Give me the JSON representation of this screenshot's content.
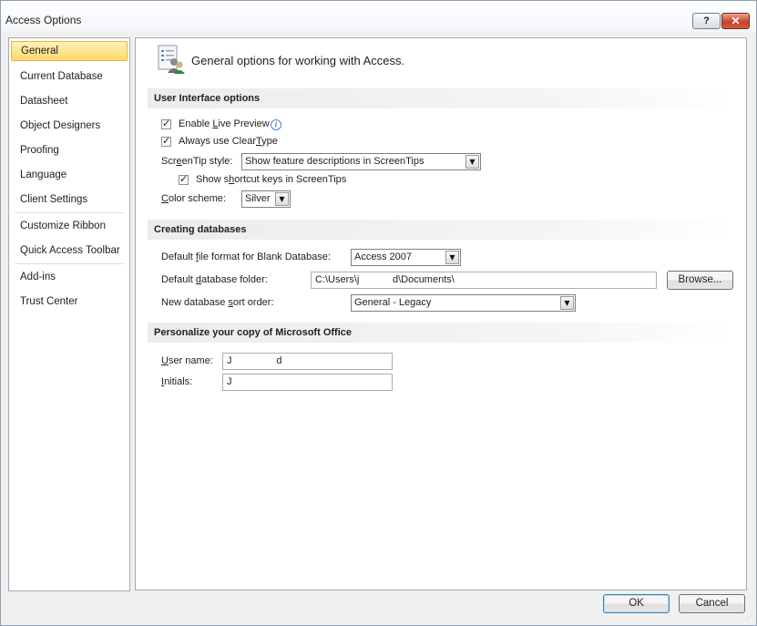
{
  "window": {
    "title": "Access Options",
    "help_label": "?",
    "close_label": "✕"
  },
  "sidebar": {
    "items": [
      {
        "label": "General",
        "selected": true
      },
      {
        "label": "Current Database"
      },
      {
        "label": "Datasheet"
      },
      {
        "label": "Object Designers"
      },
      {
        "label": "Proofing"
      },
      {
        "label": "Language"
      },
      {
        "label": "Client Settings"
      },
      {
        "label": "Customize Ribbon"
      },
      {
        "label": "Quick Access Toolbar"
      },
      {
        "label": "Add-ins"
      },
      {
        "label": "Trust Center"
      }
    ]
  },
  "header": {
    "title": "General options for working with Access.",
    "icon": "options-people-icon"
  },
  "ui_options": {
    "heading": "User Interface options",
    "live_preview": {
      "label_pre": "Enable ",
      "label_u": "L",
      "label_post": "ive Preview",
      "checked": true
    },
    "cleartype": {
      "label_pre": "Always use Clear",
      "label_u": "T",
      "label_post": "ype",
      "checked": true
    },
    "screentip": {
      "label_pre": "Scr",
      "label_u": "e",
      "label_post": "enTip style:",
      "value": "Show feature descriptions in ScreenTips"
    },
    "shortcut_keys": {
      "label_pre": "Show s",
      "label_u": "h",
      "label_post": "ortcut keys in ScreenTips",
      "checked": true
    },
    "color_scheme": {
      "label_pre": "",
      "label_u": "C",
      "label_post": "olor scheme:",
      "value": "Silver"
    }
  },
  "creating_db": {
    "heading": "Creating databases",
    "file_format": {
      "label_pre": "Default ",
      "label_u": "f",
      "label_post": "ile format for Blank Database:",
      "value": "Access 2007"
    },
    "folder": {
      "label_pre": "Default ",
      "label_u": "d",
      "label_post": "atabase folder:",
      "value": "C:\\Users\\j            d\\Documents\\"
    },
    "browse_label": "Browse...",
    "sort_order": {
      "label_pre": "New database ",
      "label_u": "s",
      "label_post": "ort order:",
      "value": "General - Legacy"
    }
  },
  "personalize": {
    "heading": "Personalize your copy of Microsoft Office",
    "user_name": {
      "label_pre": "",
      "label_u": "U",
      "label_post": "ser name:",
      "value": "J                d"
    },
    "initials": {
      "label_pre": "",
      "label_u": "I",
      "label_post": "nitials:",
      "value": "J"
    }
  },
  "footer": {
    "ok_label": "OK",
    "cancel_label": "Cancel"
  },
  "colors": {
    "selected_bg": "#ffd96d",
    "close_red": "#c5402a",
    "default_border": "#3c7fb1"
  }
}
